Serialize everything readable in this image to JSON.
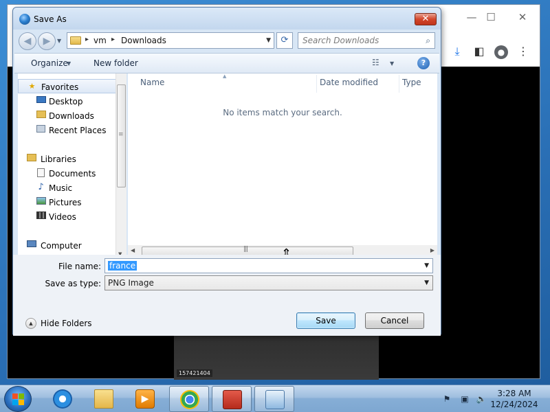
{
  "browser": {
    "window_controls": {
      "minimize": "—",
      "maximize": "☐",
      "close": "✕"
    },
    "toolbar_icons": [
      "download-icon",
      "sidebar-icon",
      "profile-icon",
      "menu-icon"
    ],
    "image_caption": "157421404"
  },
  "dialog": {
    "title": "Save As",
    "close_label": "✕",
    "breadcrumbs": [
      "vm",
      "Downloads"
    ],
    "search_placeholder": "Search Downloads",
    "toolbar": {
      "organize": "Organize",
      "organize_arrow": "▼",
      "new_folder": "New folder",
      "help": "?"
    },
    "nav": {
      "favorites": "Favorites",
      "desktop": "Desktop",
      "downloads": "Downloads",
      "recent_places": "Recent Places",
      "libraries": "Libraries",
      "documents": "Documents",
      "music": "Music",
      "pictures": "Pictures",
      "videos": "Videos",
      "computer": "Computer"
    },
    "columns": [
      "Name",
      "Date modified",
      "Type"
    ],
    "empty_message": "No items match your search.",
    "file_name_label": "File name:",
    "file_name_value": "france",
    "save_as_type_label": "Save as type:",
    "save_as_type_value": "PNG Image",
    "hide_folders": "Hide Folders",
    "save_button": "Save",
    "cancel_button": "Cancel"
  },
  "taskbar": {
    "apps": [
      "internet-explorer",
      "file-explorer",
      "media-player",
      "chrome",
      "toolbox",
      "control-panel"
    ],
    "active_app": "chrome",
    "clock_time": "3:28 AM",
    "clock_date": "12/24/2024"
  },
  "colors": {
    "dialog_bg": "#d8e6f5",
    "selection": "#3399ff",
    "taskbar": "#9fbedf"
  }
}
